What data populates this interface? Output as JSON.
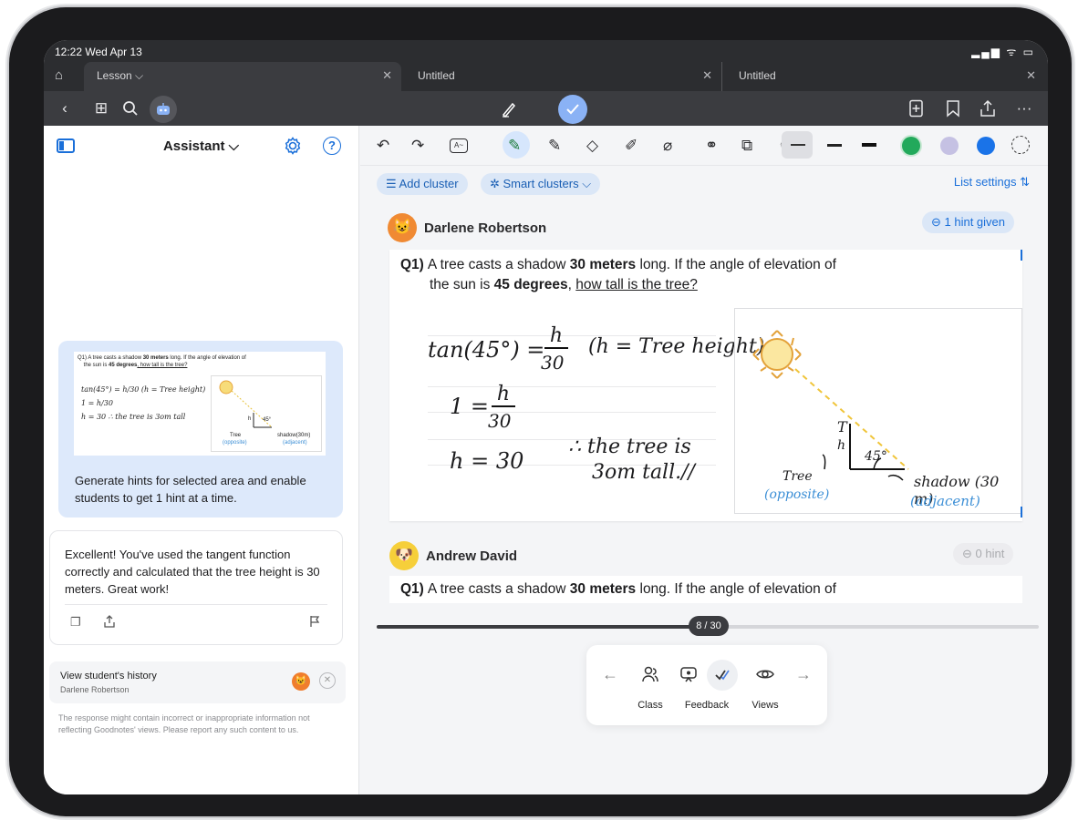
{
  "status": {
    "time": "12:22  Wed Apr 13",
    "signal": "▂▄▆ ᯤ ▭"
  },
  "tabs": [
    {
      "label": "Lesson ⌵"
    },
    {
      "label": "Untitled"
    },
    {
      "label": "Untitled"
    }
  ],
  "toolbar": {
    "icons": [
      "back-icon",
      "grid-icon",
      "search-icon",
      "assistant-icon",
      "pen-mode-icon",
      "check-mode-icon",
      "new-page-icon",
      "bookmark-icon",
      "share-icon",
      "more-icon"
    ]
  },
  "sidebar": {
    "title": "Assistant ⌵",
    "thumb": {
      "q_prefix": "Q1) A tree casts a shadow ",
      "q_bold1": "30 meters",
      "q_mid": " long. If the angle of elevation of",
      "q_line2a": "the sun is ",
      "q_bold2": "45 degrees",
      "q_line2b": ", how tall is the tree?",
      "eq1": "tan(45°) = h/30   (h = Tree height)",
      "eq2": "1 = h/30",
      "eq3": "h = 30      ∴ the tree is 3om tall",
      "lbl_h": "h",
      "lbl_angle": "45°",
      "lbl_tree": "Tree",
      "lbl_opp": "(opposite)",
      "lbl_shadow": "shadow(30m)",
      "lbl_adj": "(adjacent)"
    },
    "hint_card_text": "Generate hints for selected area and enable students to get 1 hint at a time.",
    "response_text": "Excellent! You've used the tangent function correctly and calculated that the tree height is 30 meters. Great work!",
    "history_title": "View student's history",
    "history_student": "Darlene Robertson",
    "disclaimer": "The response might contain incorrect or inappropriate information not reflecting Goodnotes' views. Please report any such content to us."
  },
  "canvas": {
    "add_cluster": "☰ Add cluster",
    "smart_clusters": "✲ Smart clusters ⌵",
    "list_settings": "List settings ⇅",
    "colors": {
      "green": "#22a95b",
      "lavender": "#c5c1e3",
      "blue": "#1a73e8"
    },
    "students": [
      {
        "name": "Darlene Robertson",
        "hint": "⊖ 1 hint given"
      },
      {
        "name": "Andrew David",
        "hint": "⊖ 0 hint"
      }
    ],
    "question": {
      "num": "Q1)",
      "pre": "A tree casts a shadow ",
      "b1": "30 meters",
      "mid": " long. If the angle of elevation of",
      "line2a": "the sun is ",
      "b2": "45 degrees",
      "line2b": ", ",
      "underlined": "how tall is the tree?"
    },
    "handwriting": {
      "eq1": "tan(45°) =",
      "frac_num": "h",
      "frac_den": "30",
      "paren": "(h = Tree height)",
      "eq2": "1 =",
      "eq3": "h = 30",
      "concl1": "∴ the tree is",
      "concl2": "3om tall.//",
      "lbl_T": "T",
      "lbl_h": "h",
      "lbl_angle": "45°",
      "lbl_tree": "Tree",
      "lbl_opposite": "(opposite)",
      "lbl_shadow": "shadow (30 m)",
      "lbl_adjacent": "(adjacent)"
    },
    "pager": "8 / 30",
    "dock": {
      "class": "Class",
      "feedback": "Feedback",
      "views": "Views"
    }
  }
}
